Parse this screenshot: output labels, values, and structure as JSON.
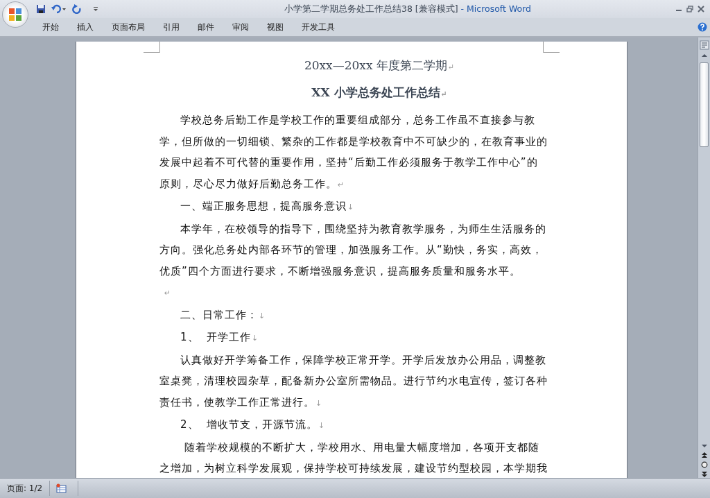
{
  "window": {
    "title_doc": "小学第二学期总务处工作总结38 [兼容模式]",
    "title_sep": " - ",
    "title_app": "Microsoft Word"
  },
  "ribbon_tabs": [
    "开始",
    "插入",
    "页面布局",
    "引用",
    "邮件",
    "审阅",
    "视图",
    "开发工具"
  ],
  "document": {
    "paragraphs": [
      {
        "kind": "title",
        "lines": [
          "20xx—20xx 年度第二学期"
        ],
        "end_mark": "↵"
      },
      {
        "kind": "title_bold",
        "lines": [
          "XX 小学总务处工作总结"
        ],
        "end_mark": "↵"
      },
      {
        "kind": "body",
        "lines": [
          "学校总务后勤工作是学校工作的重要组成部分，总务工作虽不直接参与教",
          "学，但所做的一切细锁、繁杂的工作都是学校教育中不可缺少的，在教育事业的",
          "发展中起着不可代替的重要作用，坚持“后勤工作必须服务于教学工作中心”的",
          "原则，尽心尽力做好后勤总务工作。"
        ],
        "end_mark": "↵"
      },
      {
        "kind": "body",
        "lines": [
          "一、端正服务思想，提高服务意识"
        ],
        "end_mark": "↓"
      },
      {
        "kind": "body",
        "lines": [
          "本学年，在校领导的指导下，围绕坚持为教育教学服务，为师生生活服务的",
          "方向。强化总务处内部各环节的管理，加强服务工作。从“勤快，务实，高效，",
          "优质”四个方面进行要求，不断增强服务意识，提高服务质量和服务水平。"
        ]
      },
      {
        "kind": "empty",
        "end_mark": "↵"
      },
      {
        "kind": "body",
        "lines": [
          "二、日常工作："
        ],
        "end_mark": "↓"
      },
      {
        "kind": "body",
        "lines": [
          "1、  开学工作"
        ],
        "end_mark": "↓"
      },
      {
        "kind": "body",
        "lines": [
          "认真做好开学筹备工作，保障学校正常开学。开学后发放办公用品，调整教",
          "室桌凳，清理校园杂草，配备新办公室所需物品。进行节约水电宣传，签订各种",
          "责任书，使教学工作正常进行。"
        ],
        "end_mark": "↓"
      },
      {
        "kind": "body",
        "lines": [
          "2、  增收节支，开源节流。"
        ],
        "end_mark": "↓"
      },
      {
        "kind": "body",
        "lines": [
          " 随着学校规模的不断扩大，学校用水、用电量大幅度增加，各项开支都随",
          "之增加，为树立科学发展观，保持学校可持续发展，建设节约型校园，本学期我"
        ]
      }
    ]
  },
  "status_bar": {
    "page": "页面: 1/2"
  }
}
